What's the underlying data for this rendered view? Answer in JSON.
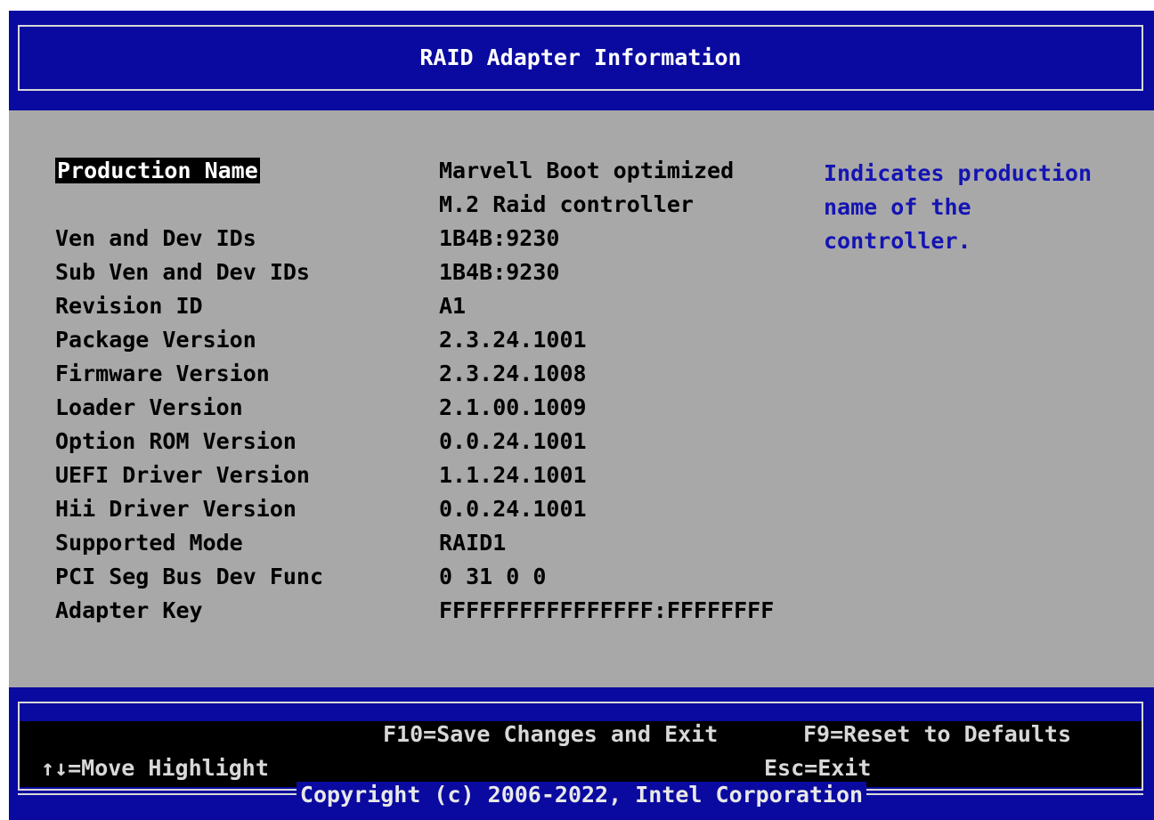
{
  "header": {
    "title": "RAID Adapter Information"
  },
  "fields": [
    {
      "label": "Production Name",
      "value": "Marvell Boot optimized"
    },
    {
      "label": "",
      "value": "M.2 Raid controller"
    },
    {
      "label": "Ven and Dev IDs",
      "value": "1B4B:9230"
    },
    {
      "label": "Sub Ven and Dev IDs",
      "value": "1B4B:9230"
    },
    {
      "label": "Revision ID",
      "value": "A1"
    },
    {
      "label": "Package Version",
      "value": "2.3.24.1001"
    },
    {
      "label": "Firmware Version",
      "value": "2.3.24.1008"
    },
    {
      "label": "Loader Version",
      "value": "2.1.00.1009"
    },
    {
      "label": "Option ROM Version",
      "value": "0.0.24.1001"
    },
    {
      "label": "UEFI Driver Version",
      "value": "1.1.24.1001"
    },
    {
      "label": "Hii Driver Version",
      "value": "0.0.24.1001"
    },
    {
      "label": "Supported Mode",
      "value": "RAID1"
    },
    {
      "label": "PCI Seg Bus Dev Func",
      "value": "0 31 0 0"
    },
    {
      "label": "Adapter Key",
      "value": "FFFFFFFFFFFFFFFF:FFFFFFFF"
    }
  ],
  "help": {
    "lines": [
      "Indicates production",
      "name of the",
      "controller."
    ]
  },
  "footer": {
    "save_exit": "F10=Save Changes and Exit",
    "reset_defaults": "F9=Reset to Defaults",
    "move_highlight": "↑↓=Move Highlight",
    "esc_exit": "Esc=Exit",
    "copyright": "Copyright (c) 2006-2022, Intel Corporation"
  },
  "colors": {
    "background_blue": "#0a0aa0",
    "body_gray": "#a8a8a8",
    "help_text_blue": "#1414b4",
    "highlight_bg": "#000000",
    "highlight_fg": "#ffffff"
  }
}
